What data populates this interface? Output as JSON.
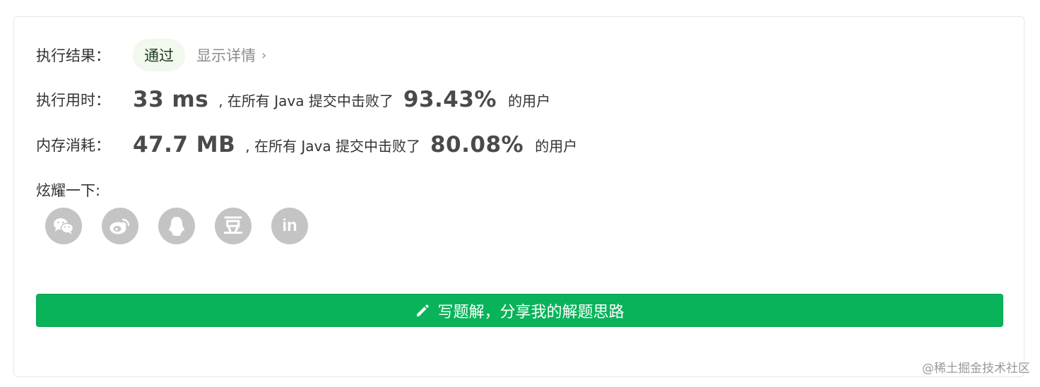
{
  "result": {
    "label": "执行结果：",
    "status": "通过",
    "details_link": "显示详情",
    "details_chevron": "›"
  },
  "runtime": {
    "label": "执行用时：",
    "value": "33 ms",
    "middle_text": ", 在所有 Java 提交中击败了",
    "percent": "93.43%",
    "tail_text": "的用户"
  },
  "memory": {
    "label": "内存消耗：",
    "value": "47.7 MB",
    "middle_text": ", 在所有 Java 提交中击败了",
    "percent": "80.08%",
    "tail_text": "的用户"
  },
  "share": {
    "label": "炫耀一下:",
    "icons": [
      "wechat-icon",
      "weibo-icon",
      "qq-icon",
      "douban-icon",
      "linkedin-icon"
    ],
    "douban_glyph": "豆",
    "linkedin_glyph": "in"
  },
  "write_solution": {
    "label": "写题解，分享我的解题思路",
    "icon": "pencil-icon"
  },
  "watermark": "@稀土掘金技术社区",
  "colors": {
    "accent_green": "#09b35a",
    "badge_bg": "#f3f8ef",
    "icon_gray": "#c4c4c4"
  }
}
